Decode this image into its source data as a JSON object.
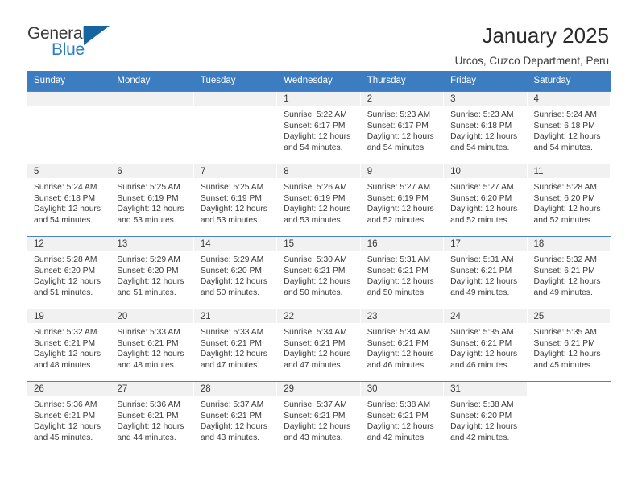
{
  "brand": {
    "name_part1": "General",
    "name_part2": "Blue"
  },
  "header": {
    "title": "January 2025",
    "location": "Urcos, Cuzco Department, Peru"
  },
  "calendar": {
    "weekday_headers": [
      "Sunday",
      "Monday",
      "Tuesday",
      "Wednesday",
      "Thursday",
      "Friday",
      "Saturday"
    ],
    "colors": {
      "header_blue": "#3b7dc0",
      "row_divider_blue": "#4a86c5",
      "daynum_band": "#f1f1f1",
      "brand_blue": "#2b7cc4",
      "logo_triangle": "#17659e"
    },
    "weeks": [
      [
        {
          "day": "",
          "empty": true
        },
        {
          "day": "",
          "empty": true
        },
        {
          "day": "",
          "empty": true
        },
        {
          "day": "1",
          "sunrise": "Sunrise: 5:22 AM",
          "sunset": "Sunset: 6:17 PM",
          "daylight1": "Daylight: 12 hours",
          "daylight2": "and 54 minutes."
        },
        {
          "day": "2",
          "sunrise": "Sunrise: 5:23 AM",
          "sunset": "Sunset: 6:17 PM",
          "daylight1": "Daylight: 12 hours",
          "daylight2": "and 54 minutes."
        },
        {
          "day": "3",
          "sunrise": "Sunrise: 5:23 AM",
          "sunset": "Sunset: 6:18 PM",
          "daylight1": "Daylight: 12 hours",
          "daylight2": "and 54 minutes."
        },
        {
          "day": "4",
          "sunrise": "Sunrise: 5:24 AM",
          "sunset": "Sunset: 6:18 PM",
          "daylight1": "Daylight: 12 hours",
          "daylight2": "and 54 minutes."
        }
      ],
      [
        {
          "day": "5",
          "sunrise": "Sunrise: 5:24 AM",
          "sunset": "Sunset: 6:18 PM",
          "daylight1": "Daylight: 12 hours",
          "daylight2": "and 54 minutes."
        },
        {
          "day": "6",
          "sunrise": "Sunrise: 5:25 AM",
          "sunset": "Sunset: 6:19 PM",
          "daylight1": "Daylight: 12 hours",
          "daylight2": "and 53 minutes."
        },
        {
          "day": "7",
          "sunrise": "Sunrise: 5:25 AM",
          "sunset": "Sunset: 6:19 PM",
          "daylight1": "Daylight: 12 hours",
          "daylight2": "and 53 minutes."
        },
        {
          "day": "8",
          "sunrise": "Sunrise: 5:26 AM",
          "sunset": "Sunset: 6:19 PM",
          "daylight1": "Daylight: 12 hours",
          "daylight2": "and 53 minutes."
        },
        {
          "day": "9",
          "sunrise": "Sunrise: 5:27 AM",
          "sunset": "Sunset: 6:19 PM",
          "daylight1": "Daylight: 12 hours",
          "daylight2": "and 52 minutes."
        },
        {
          "day": "10",
          "sunrise": "Sunrise: 5:27 AM",
          "sunset": "Sunset: 6:20 PM",
          "daylight1": "Daylight: 12 hours",
          "daylight2": "and 52 minutes."
        },
        {
          "day": "11",
          "sunrise": "Sunrise: 5:28 AM",
          "sunset": "Sunset: 6:20 PM",
          "daylight1": "Daylight: 12 hours",
          "daylight2": "and 52 minutes."
        }
      ],
      [
        {
          "day": "12",
          "sunrise": "Sunrise: 5:28 AM",
          "sunset": "Sunset: 6:20 PM",
          "daylight1": "Daylight: 12 hours",
          "daylight2": "and 51 minutes."
        },
        {
          "day": "13",
          "sunrise": "Sunrise: 5:29 AM",
          "sunset": "Sunset: 6:20 PM",
          "daylight1": "Daylight: 12 hours",
          "daylight2": "and 51 minutes."
        },
        {
          "day": "14",
          "sunrise": "Sunrise: 5:29 AM",
          "sunset": "Sunset: 6:20 PM",
          "daylight1": "Daylight: 12 hours",
          "daylight2": "and 50 minutes."
        },
        {
          "day": "15",
          "sunrise": "Sunrise: 5:30 AM",
          "sunset": "Sunset: 6:21 PM",
          "daylight1": "Daylight: 12 hours",
          "daylight2": "and 50 minutes."
        },
        {
          "day": "16",
          "sunrise": "Sunrise: 5:31 AM",
          "sunset": "Sunset: 6:21 PM",
          "daylight1": "Daylight: 12 hours",
          "daylight2": "and 50 minutes."
        },
        {
          "day": "17",
          "sunrise": "Sunrise: 5:31 AM",
          "sunset": "Sunset: 6:21 PM",
          "daylight1": "Daylight: 12 hours",
          "daylight2": "and 49 minutes."
        },
        {
          "day": "18",
          "sunrise": "Sunrise: 5:32 AM",
          "sunset": "Sunset: 6:21 PM",
          "daylight1": "Daylight: 12 hours",
          "daylight2": "and 49 minutes."
        }
      ],
      [
        {
          "day": "19",
          "sunrise": "Sunrise: 5:32 AM",
          "sunset": "Sunset: 6:21 PM",
          "daylight1": "Daylight: 12 hours",
          "daylight2": "and 48 minutes."
        },
        {
          "day": "20",
          "sunrise": "Sunrise: 5:33 AM",
          "sunset": "Sunset: 6:21 PM",
          "daylight1": "Daylight: 12 hours",
          "daylight2": "and 48 minutes."
        },
        {
          "day": "21",
          "sunrise": "Sunrise: 5:33 AM",
          "sunset": "Sunset: 6:21 PM",
          "daylight1": "Daylight: 12 hours",
          "daylight2": "and 47 minutes."
        },
        {
          "day": "22",
          "sunrise": "Sunrise: 5:34 AM",
          "sunset": "Sunset: 6:21 PM",
          "daylight1": "Daylight: 12 hours",
          "daylight2": "and 47 minutes."
        },
        {
          "day": "23",
          "sunrise": "Sunrise: 5:34 AM",
          "sunset": "Sunset: 6:21 PM",
          "daylight1": "Daylight: 12 hours",
          "daylight2": "and 46 minutes."
        },
        {
          "day": "24",
          "sunrise": "Sunrise: 5:35 AM",
          "sunset": "Sunset: 6:21 PM",
          "daylight1": "Daylight: 12 hours",
          "daylight2": "and 46 minutes."
        },
        {
          "day": "25",
          "sunrise": "Sunrise: 5:35 AM",
          "sunset": "Sunset: 6:21 PM",
          "daylight1": "Daylight: 12 hours",
          "daylight2": "and 45 minutes."
        }
      ],
      [
        {
          "day": "26",
          "sunrise": "Sunrise: 5:36 AM",
          "sunset": "Sunset: 6:21 PM",
          "daylight1": "Daylight: 12 hours",
          "daylight2": "and 45 minutes."
        },
        {
          "day": "27",
          "sunrise": "Sunrise: 5:36 AM",
          "sunset": "Sunset: 6:21 PM",
          "daylight1": "Daylight: 12 hours",
          "daylight2": "and 44 minutes."
        },
        {
          "day": "28",
          "sunrise": "Sunrise: 5:37 AM",
          "sunset": "Sunset: 6:21 PM",
          "daylight1": "Daylight: 12 hours",
          "daylight2": "and 43 minutes."
        },
        {
          "day": "29",
          "sunrise": "Sunrise: 5:37 AM",
          "sunset": "Sunset: 6:21 PM",
          "daylight1": "Daylight: 12 hours",
          "daylight2": "and 43 minutes."
        },
        {
          "day": "30",
          "sunrise": "Sunrise: 5:38 AM",
          "sunset": "Sunset: 6:21 PM",
          "daylight1": "Daylight: 12 hours",
          "daylight2": "and 42 minutes."
        },
        {
          "day": "31",
          "sunrise": "Sunrise: 5:38 AM",
          "sunset": "Sunset: 6:20 PM",
          "daylight1": "Daylight: 12 hours",
          "daylight2": "and 42 minutes."
        },
        {
          "day": "",
          "empty": true,
          "blank": true
        }
      ]
    ]
  }
}
